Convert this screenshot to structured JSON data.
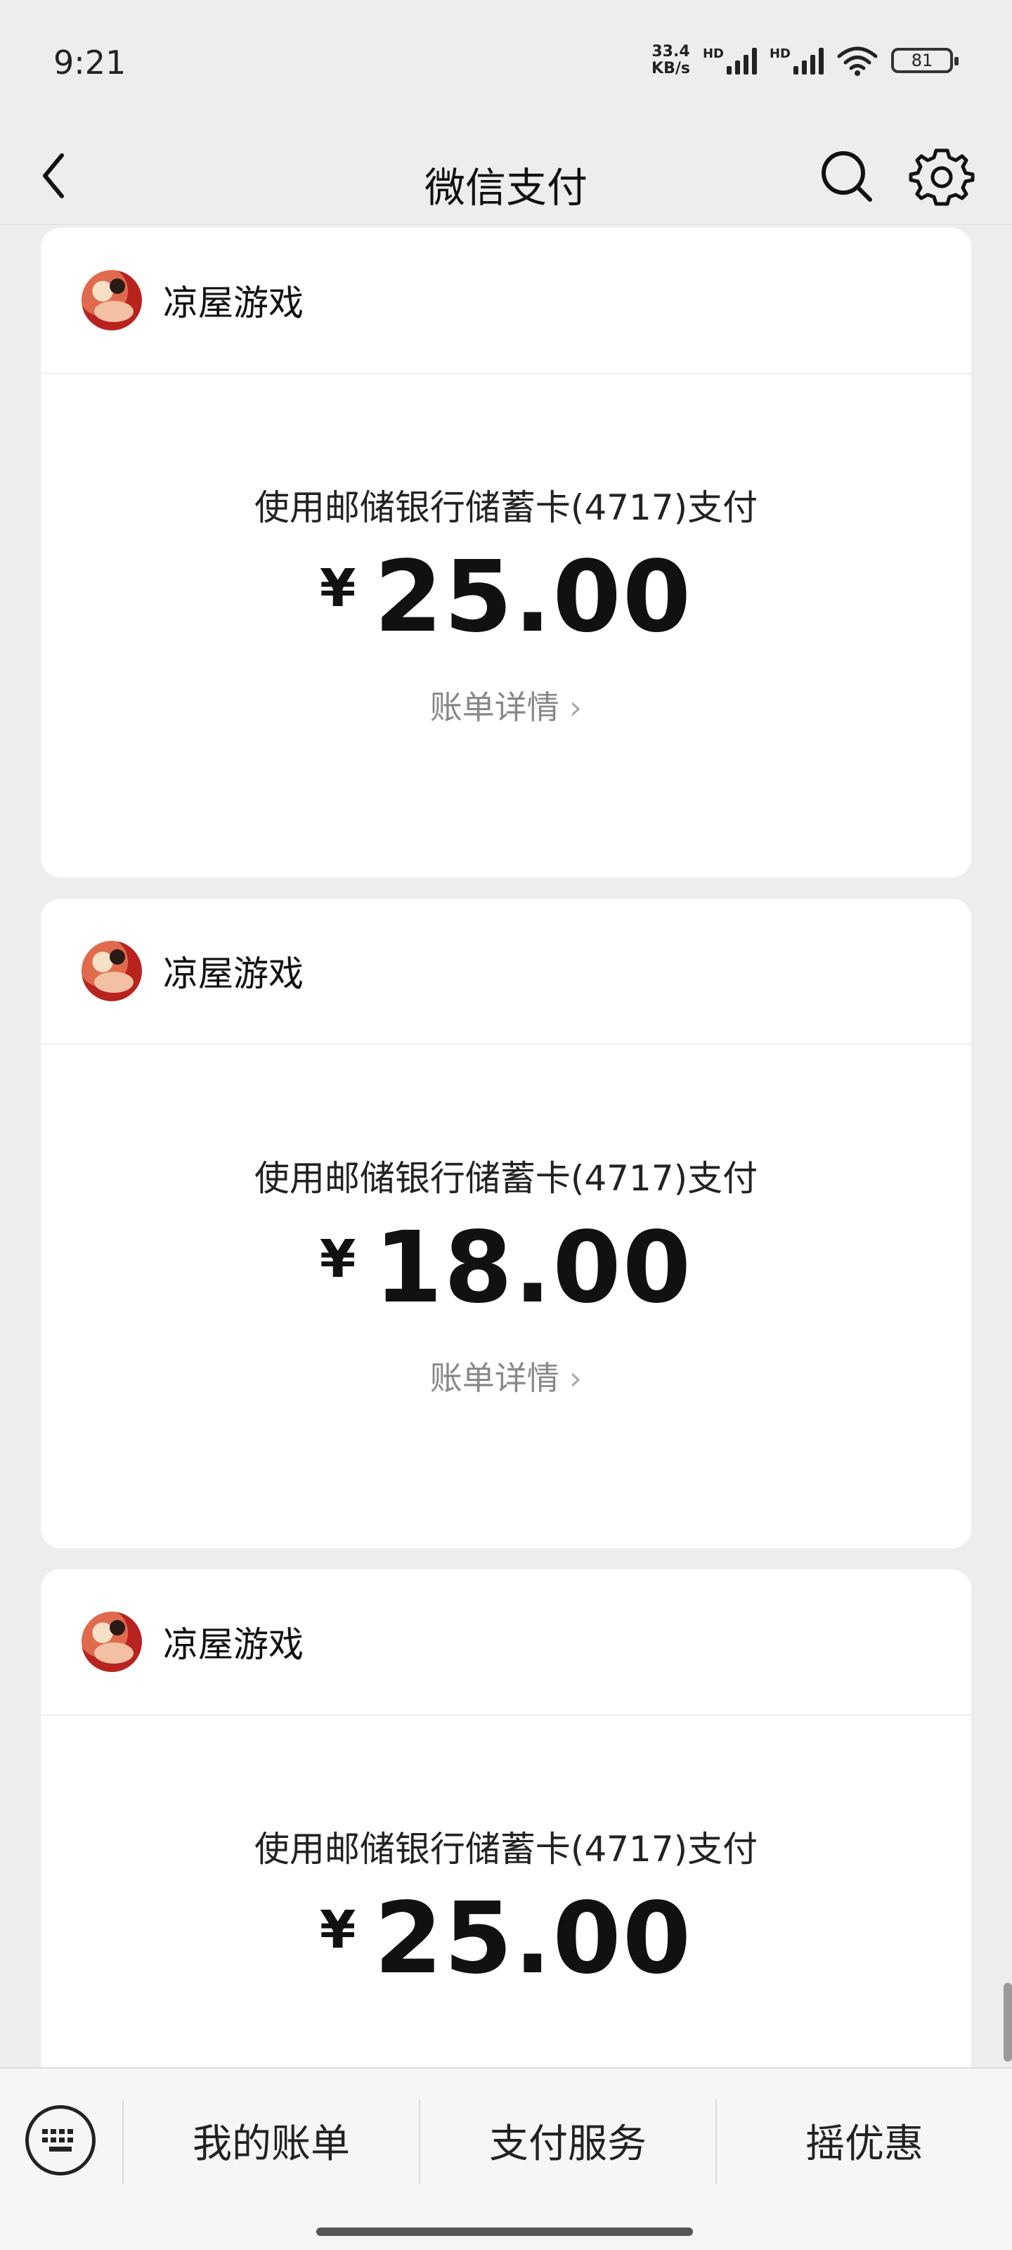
{
  "status_bar": {
    "time": "9:21",
    "network_speed_value": "33.4",
    "network_speed_unit": "KB/s",
    "sim1_label": "HD",
    "sim2_label": "HD",
    "battery": "81"
  },
  "nav": {
    "title": "微信支付",
    "back_icon": "chevron-left-icon",
    "search_icon": "search-icon",
    "settings_icon": "gear-icon"
  },
  "cards": [
    {
      "merchant": "凉屋游戏",
      "method": "使用邮储银行储蓄卡(4717)支付",
      "currency": "¥",
      "amount": "25.00",
      "detail_label": "账单详情",
      "detail_chevron": "›"
    },
    {
      "merchant": "凉屋游戏",
      "method": "使用邮储银行储蓄卡(4717)支付",
      "currency": "¥",
      "amount": "18.00",
      "detail_label": "账单详情",
      "detail_chevron": "›"
    },
    {
      "merchant": "凉屋游戏",
      "method": "使用邮储银行储蓄卡(4717)支付",
      "currency": "¥",
      "amount": "25.00"
    }
  ],
  "bottom_menu": {
    "keyboard_icon": "keyboard-icon",
    "items": [
      "我的账单",
      "支付服务",
      "摇优惠"
    ]
  }
}
